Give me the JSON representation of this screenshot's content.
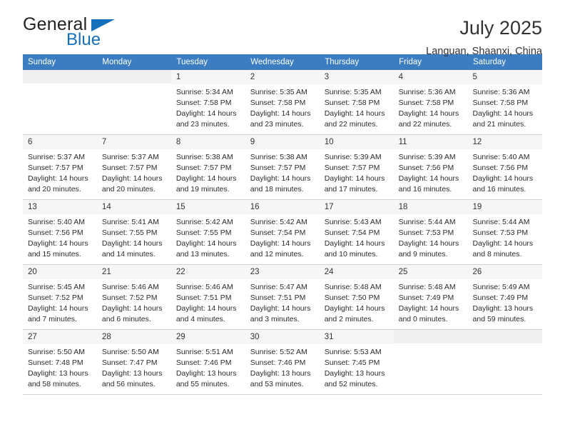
{
  "brand": {
    "name_top": "General",
    "name_bottom": "Blue",
    "accent_color": "#1570bb"
  },
  "header": {
    "title": "July 2025",
    "subtitle": "Languan, Shaanxi, China"
  },
  "theme": {
    "header_row_bg": "#3b7dc0",
    "day_label_bg": "#f0f0f0",
    "grid_line": "#d2d2d2"
  },
  "weekdays": [
    "Sunday",
    "Monday",
    "Tuesday",
    "Wednesday",
    "Thursday",
    "Friday",
    "Saturday"
  ],
  "weeks": [
    [
      {
        "day": "",
        "lines": []
      },
      {
        "day": "",
        "lines": []
      },
      {
        "day": "1",
        "lines": [
          "Sunrise: 5:34 AM",
          "Sunset: 7:58 PM",
          "Daylight: 14 hours",
          "and 23 minutes."
        ]
      },
      {
        "day": "2",
        "lines": [
          "Sunrise: 5:35 AM",
          "Sunset: 7:58 PM",
          "Daylight: 14 hours",
          "and 23 minutes."
        ]
      },
      {
        "day": "3",
        "lines": [
          "Sunrise: 5:35 AM",
          "Sunset: 7:58 PM",
          "Daylight: 14 hours",
          "and 22 minutes."
        ]
      },
      {
        "day": "4",
        "lines": [
          "Sunrise: 5:36 AM",
          "Sunset: 7:58 PM",
          "Daylight: 14 hours",
          "and 22 minutes."
        ]
      },
      {
        "day": "5",
        "lines": [
          "Sunrise: 5:36 AM",
          "Sunset: 7:58 PM",
          "Daylight: 14 hours",
          "and 21 minutes."
        ]
      }
    ],
    [
      {
        "day": "6",
        "lines": [
          "Sunrise: 5:37 AM",
          "Sunset: 7:57 PM",
          "Daylight: 14 hours",
          "and 20 minutes."
        ]
      },
      {
        "day": "7",
        "lines": [
          "Sunrise: 5:37 AM",
          "Sunset: 7:57 PM",
          "Daylight: 14 hours",
          "and 20 minutes."
        ]
      },
      {
        "day": "8",
        "lines": [
          "Sunrise: 5:38 AM",
          "Sunset: 7:57 PM",
          "Daylight: 14 hours",
          "and 19 minutes."
        ]
      },
      {
        "day": "9",
        "lines": [
          "Sunrise: 5:38 AM",
          "Sunset: 7:57 PM",
          "Daylight: 14 hours",
          "and 18 minutes."
        ]
      },
      {
        "day": "10",
        "lines": [
          "Sunrise: 5:39 AM",
          "Sunset: 7:57 PM",
          "Daylight: 14 hours",
          "and 17 minutes."
        ]
      },
      {
        "day": "11",
        "lines": [
          "Sunrise: 5:39 AM",
          "Sunset: 7:56 PM",
          "Daylight: 14 hours",
          "and 16 minutes."
        ]
      },
      {
        "day": "12",
        "lines": [
          "Sunrise: 5:40 AM",
          "Sunset: 7:56 PM",
          "Daylight: 14 hours",
          "and 16 minutes."
        ]
      }
    ],
    [
      {
        "day": "13",
        "lines": [
          "Sunrise: 5:40 AM",
          "Sunset: 7:56 PM",
          "Daylight: 14 hours",
          "and 15 minutes."
        ]
      },
      {
        "day": "14",
        "lines": [
          "Sunrise: 5:41 AM",
          "Sunset: 7:55 PM",
          "Daylight: 14 hours",
          "and 14 minutes."
        ]
      },
      {
        "day": "15",
        "lines": [
          "Sunrise: 5:42 AM",
          "Sunset: 7:55 PM",
          "Daylight: 14 hours",
          "and 13 minutes."
        ]
      },
      {
        "day": "16",
        "lines": [
          "Sunrise: 5:42 AM",
          "Sunset: 7:54 PM",
          "Daylight: 14 hours",
          "and 12 minutes."
        ]
      },
      {
        "day": "17",
        "lines": [
          "Sunrise: 5:43 AM",
          "Sunset: 7:54 PM",
          "Daylight: 14 hours",
          "and 10 minutes."
        ]
      },
      {
        "day": "18",
        "lines": [
          "Sunrise: 5:44 AM",
          "Sunset: 7:53 PM",
          "Daylight: 14 hours",
          "and 9 minutes."
        ]
      },
      {
        "day": "19",
        "lines": [
          "Sunrise: 5:44 AM",
          "Sunset: 7:53 PM",
          "Daylight: 14 hours",
          "and 8 minutes."
        ]
      }
    ],
    [
      {
        "day": "20",
        "lines": [
          "Sunrise: 5:45 AM",
          "Sunset: 7:52 PM",
          "Daylight: 14 hours",
          "and 7 minutes."
        ]
      },
      {
        "day": "21",
        "lines": [
          "Sunrise: 5:46 AM",
          "Sunset: 7:52 PM",
          "Daylight: 14 hours",
          "and 6 minutes."
        ]
      },
      {
        "day": "22",
        "lines": [
          "Sunrise: 5:46 AM",
          "Sunset: 7:51 PM",
          "Daylight: 14 hours",
          "and 4 minutes."
        ]
      },
      {
        "day": "23",
        "lines": [
          "Sunrise: 5:47 AM",
          "Sunset: 7:51 PM",
          "Daylight: 14 hours",
          "and 3 minutes."
        ]
      },
      {
        "day": "24",
        "lines": [
          "Sunrise: 5:48 AM",
          "Sunset: 7:50 PM",
          "Daylight: 14 hours",
          "and 2 minutes."
        ]
      },
      {
        "day": "25",
        "lines": [
          "Sunrise: 5:48 AM",
          "Sunset: 7:49 PM",
          "Daylight: 14 hours",
          "and 0 minutes."
        ]
      },
      {
        "day": "26",
        "lines": [
          "Sunrise: 5:49 AM",
          "Sunset: 7:49 PM",
          "Daylight: 13 hours",
          "and 59 minutes."
        ]
      }
    ],
    [
      {
        "day": "27",
        "lines": [
          "Sunrise: 5:50 AM",
          "Sunset: 7:48 PM",
          "Daylight: 13 hours",
          "and 58 minutes."
        ]
      },
      {
        "day": "28",
        "lines": [
          "Sunrise: 5:50 AM",
          "Sunset: 7:47 PM",
          "Daylight: 13 hours",
          "and 56 minutes."
        ]
      },
      {
        "day": "29",
        "lines": [
          "Sunrise: 5:51 AM",
          "Sunset: 7:46 PM",
          "Daylight: 13 hours",
          "and 55 minutes."
        ]
      },
      {
        "day": "30",
        "lines": [
          "Sunrise: 5:52 AM",
          "Sunset: 7:46 PM",
          "Daylight: 13 hours",
          "and 53 minutes."
        ]
      },
      {
        "day": "31",
        "lines": [
          "Sunrise: 5:53 AM",
          "Sunset: 7:45 PM",
          "Daylight: 13 hours",
          "and 52 minutes."
        ]
      },
      {
        "day": "",
        "lines": []
      },
      {
        "day": "",
        "lines": []
      }
    ]
  ]
}
